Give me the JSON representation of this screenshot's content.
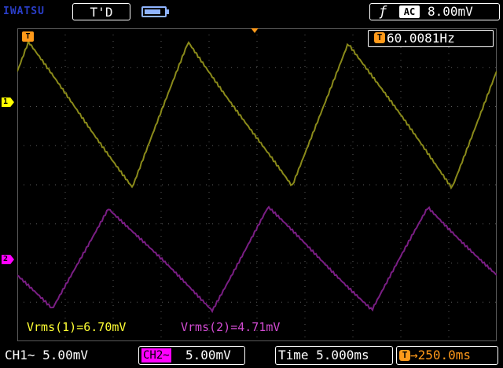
{
  "header": {
    "brand": "IWATSU",
    "acquisition_state": "T'D",
    "battery_level": 0.85,
    "trigger_edge_icon": "rising-edge-icon",
    "trigger_edge_glyph": "ƒ",
    "trigger_coupling": "AC",
    "trigger_level": "8.00mV"
  },
  "markers": {
    "trigger_position": "T",
    "ch1": "1",
    "ch2": "2"
  },
  "frequency": {
    "icon": "T",
    "value": "60.0081Hz"
  },
  "measurements": {
    "ch1": "Vrms(1)=6.70mV",
    "ch2": "Vrms(2)=4.71mV"
  },
  "footer": {
    "ch1_scale": "CH1∼ 5.00mV",
    "ch2_tag": "CH2∼",
    "ch2_scale": "5.00mV",
    "timebase": "Time 5.000ms",
    "delay_icon": "T",
    "delay": "→250.0ms"
  },
  "colors": {
    "ch1": "#8a8a1a",
    "ch2": "#7a1e84",
    "trigger": "#ff9a1a",
    "grid": "#5a5a5a",
    "brand": "#2a3ec8"
  },
  "waveforms": {
    "frequency_hz": 60.0081,
    "timebase_ms_per_div": 5.0,
    "ch1_vrms_mV": 6.7,
    "ch2_vrms_mV": 4.71
  }
}
